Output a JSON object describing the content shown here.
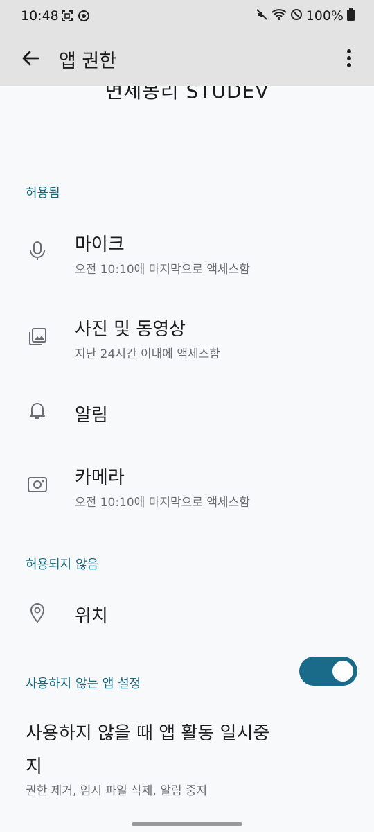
{
  "status_bar": {
    "time": "10:48",
    "battery": "100%"
  },
  "app_bar": {
    "title": "앱 권한"
  },
  "app_name": "면세몽리 STUDEV",
  "sections": {
    "allowed_header": "허용됨",
    "not_allowed_header": "허용되지 않음",
    "unused_header": "사용하지 않는 앱 설정"
  },
  "allowed": [
    {
      "icon": "microphone-icon",
      "title": "마이크",
      "subtitle": "오전 10:10에 마지막으로 액세스함"
    },
    {
      "icon": "photo-gallery-icon",
      "title": "사진 및 동영상",
      "subtitle": "지난 24시간 이내에 액세스함"
    },
    {
      "icon": "bell-icon",
      "title": "알림",
      "subtitle": ""
    },
    {
      "icon": "camera-icon",
      "title": "카메라",
      "subtitle": "오전 10:10에 마지막으로 액세스함"
    }
  ],
  "not_allowed": [
    {
      "icon": "location-pin-icon",
      "title": "위치"
    }
  ],
  "unused_setting": {
    "title": "사용하지 않을 때 앱 활동 일시중지",
    "subtitle": "권한 제거, 임시 파일 삭제, 알림 중지",
    "enabled": true
  },
  "colors": {
    "accent": "#1a6a7f",
    "switch_on": "#1a6a8a",
    "appbar_bg": "#e3e3e3",
    "page_bg": "#f7f9fb"
  }
}
